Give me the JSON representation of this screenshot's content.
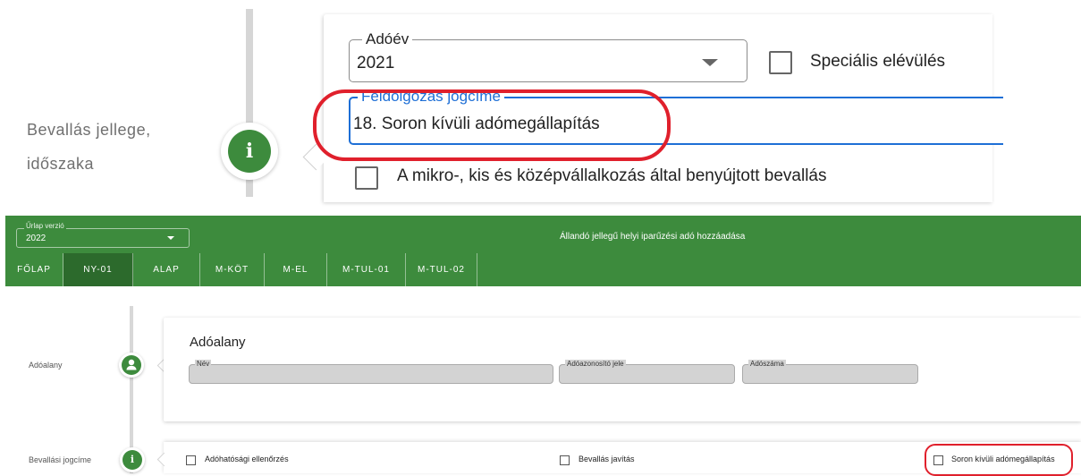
{
  "zoom": {
    "side_label_line1": "Bevallás jellege,",
    "side_label_line2": "időszaka",
    "info_glyph": "i",
    "adoev": {
      "label": "Adóév",
      "value": "2021"
    },
    "specialis_label": "Speciális elévülés",
    "feldolgozas": {
      "label": "Feldolgozás jogcíme",
      "value": "18. Soron kívüli adómegállapítás"
    },
    "kkv_label": "A mikro-, kis és középvállalkozás által benyújtott bevallás"
  },
  "app": {
    "version": {
      "label": "Űrlap verzió",
      "value": "2022"
    },
    "title": "Állandó jellegű helyi iparűzési adó hozzáadása",
    "tabs": [
      {
        "label": "FŐLAP",
        "active": false
      },
      {
        "label": "NY-01",
        "active": true
      },
      {
        "label": "ALAP",
        "active": false
      },
      {
        "label": "M-KÖT",
        "active": false
      },
      {
        "label": "M-EL",
        "active": false
      },
      {
        "label": "M-TUL-01",
        "active": false
      },
      {
        "label": "M-TUL-02",
        "active": false
      }
    ],
    "adoalany": {
      "side_label": "Adóalany",
      "icon": "person-icon",
      "title": "Adóalany",
      "fields": {
        "nev": "Név",
        "adoazonosito": "Adóazonosító jele",
        "adoszama": "Adószáma"
      }
    },
    "jogcime": {
      "side_label": "Bevallási jogcíme",
      "info_glyph": "i",
      "options": {
        "adohatosagi": "Adóhatósági ellenőrzés",
        "javitas": "Bevallás javítás",
        "soron_kivuli": "Soron kívüli adómegállapítás"
      }
    }
  },
  "colors": {
    "primary_green": "#3d8b3d",
    "active_tab": "#2c6a2c",
    "highlight_red": "#e0202c",
    "focus_blue": "#1e6fd6"
  }
}
